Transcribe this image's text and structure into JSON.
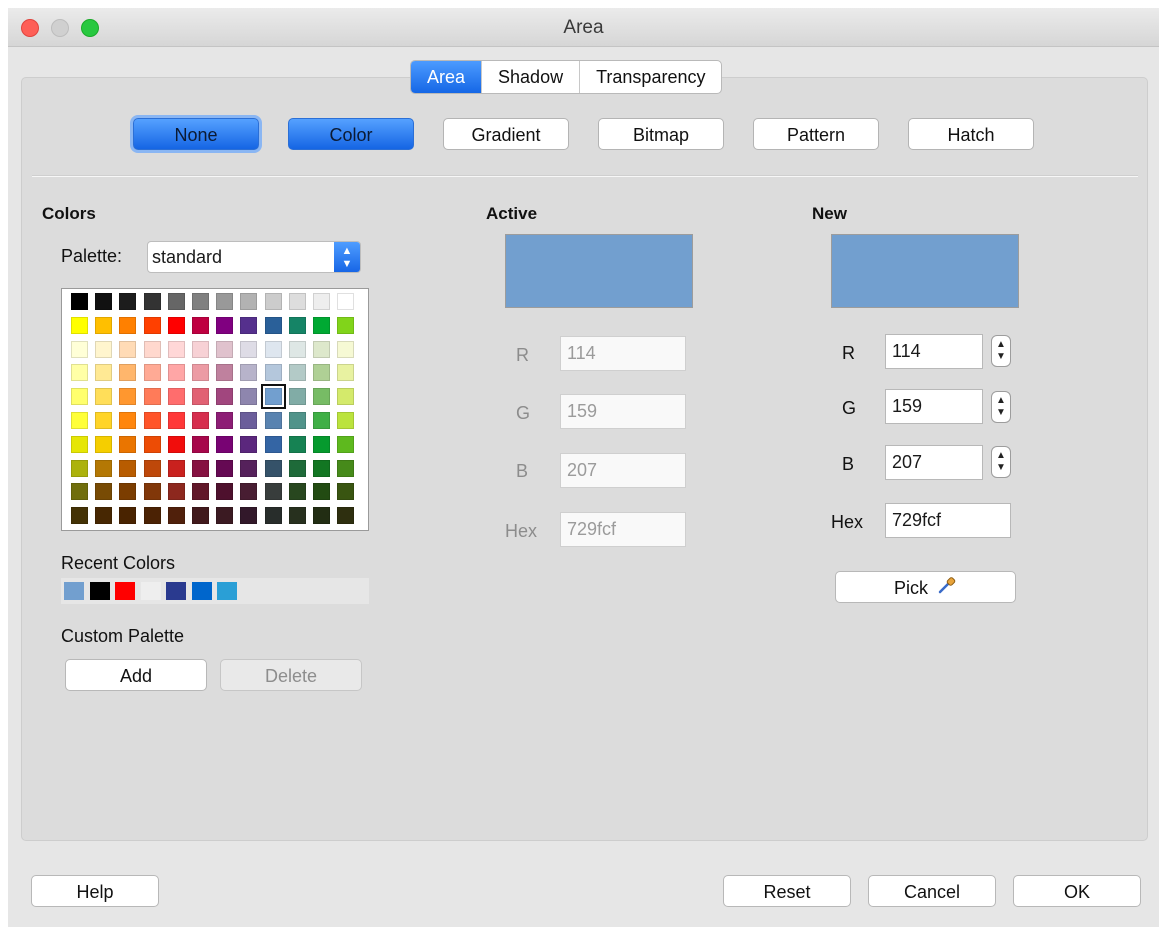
{
  "window": {
    "title": "Area"
  },
  "tabs": [
    {
      "label": "Area",
      "active": true
    },
    {
      "label": "Shadow",
      "active": false
    },
    {
      "label": "Transparency",
      "active": false
    }
  ],
  "fill_types": [
    {
      "label": "None"
    },
    {
      "label": "Color"
    },
    {
      "label": "Gradient"
    },
    {
      "label": "Bitmap"
    },
    {
      "label": "Pattern"
    },
    {
      "label": "Hatch"
    }
  ],
  "colors": {
    "heading": "Colors",
    "palette_label": "Palette:",
    "palette_value": "standard",
    "swatches": [
      [
        "#000000",
        "#111111",
        "#1c1c1c",
        "#333333",
        "#666666",
        "#808080",
        "#999999",
        "#b2b2b2",
        "#cccccc",
        "#dddddd",
        "#eeeeee",
        "#ffffff"
      ],
      [
        "#ffff00",
        "#ffbf00",
        "#ff8000",
        "#ff4000",
        "#ff0000",
        "#bf0041",
        "#800080",
        "#55308d",
        "#2a6099",
        "#158466",
        "#00a933",
        "#81d41a"
      ],
      [
        "#ffffd7",
        "#fff5ce",
        "#ffdbb6",
        "#ffd8ce",
        "#ffd7d7",
        "#f7d1d5",
        "#e0c2cd",
        "#dedce6",
        "#dee6ef",
        "#dee7e5",
        "#dde8cb",
        "#f6f9d4"
      ],
      [
        "#ffffa6",
        "#ffe994",
        "#ffb66c",
        "#ffaa95",
        "#ffa6a6",
        "#ec9ba4",
        "#bf819e",
        "#b7b3ca",
        "#b4c7dc",
        "#b3cac7",
        "#afd095",
        "#e8f2a1"
      ],
      [
        "#ffff6d",
        "#ffde59",
        "#ff972f",
        "#ff7b59",
        "#ff6d6d",
        "#e16173",
        "#a1467e",
        "#8e86ae",
        "#729fcf",
        "#81aca6",
        "#77bc65",
        "#d4ea6b"
      ],
      [
        "#ffff38",
        "#ffd428",
        "#ff860d",
        "#ff5429",
        "#ff3838",
        "#d62e4e",
        "#8d1d75",
        "#6b5e9b",
        "#5983b0",
        "#50938a",
        "#3faf46",
        "#bbe33d"
      ],
      [
        "#e6e605",
        "#f5ce00",
        "#ea7500",
        "#ed4c05",
        "#f10d0c",
        "#a7074b",
        "#780373",
        "#5b277d",
        "#3465a4",
        "#168253",
        "#069a2e",
        "#5eb91e"
      ],
      [
        "#acb20c",
        "#b47804",
        "#b85c00",
        "#be480a",
        "#c9211e",
        "#861141",
        "#650953",
        "#55215b",
        "#355269",
        "#1e6a39",
        "#127622",
        "#468a1a"
      ],
      [
        "#706e0c",
        "#784b04",
        "#7b3d00",
        "#813709",
        "#8d281e",
        "#611729",
        "#4e102d",
        "#481d32",
        "#383d3c",
        "#28471f",
        "#224b12",
        "#395511"
      ],
      [
        "#443205",
        "#472702",
        "#492300",
        "#4b2204",
        "#50200b",
        "#41191c",
        "#3b1a22",
        "#32182a",
        "#282d2b",
        "#27301e",
        "#222d13",
        "#2e2f0f"
      ]
    ],
    "selected_swatch": {
      "row": 4,
      "col": 8
    },
    "recent_label": "Recent Colors",
    "recent": [
      "#729fcf",
      "#000000",
      "#ff0000",
      "#eeeeee",
      "#2a3a8f",
      "#0066cc",
      "#2a9fd6"
    ],
    "custom_label": "Custom Palette",
    "add_label": "Add",
    "delete_label": "Delete"
  },
  "active": {
    "heading": "Active",
    "color": "#729fcf",
    "r_label": "R",
    "r_value": "114",
    "g_label": "G",
    "g_value": "159",
    "b_label": "B",
    "b_value": "207",
    "hex_label": "Hex",
    "hex_value": "729fcf"
  },
  "new": {
    "heading": "New",
    "color": "#729fcf",
    "r_label": "R",
    "r_value": "114",
    "g_label": "G",
    "g_value": "159",
    "b_label": "B",
    "b_value": "207",
    "hex_label": "Hex",
    "hex_value": "729fcf",
    "pick_label": "Pick"
  },
  "footer": {
    "help_label": "Help",
    "reset_label": "Reset",
    "cancel_label": "Cancel",
    "ok_label": "OK"
  }
}
